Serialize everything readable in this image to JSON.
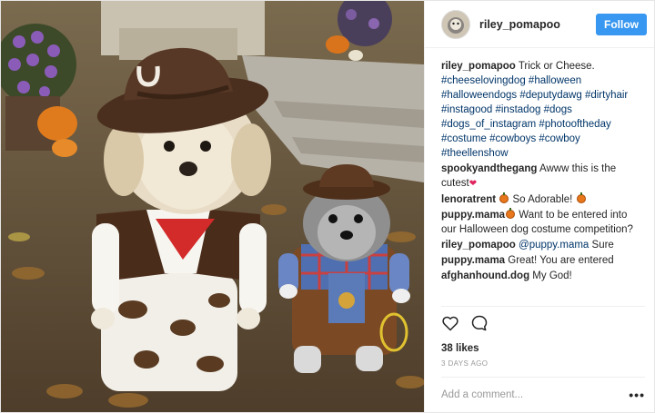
{
  "media": {
    "description_icon": "photo"
  },
  "header": {
    "username": "riley_pomapoo",
    "follow_label": "Follow"
  },
  "caption": {
    "author": "riley_pomapoo",
    "text": "Trick or Cheese.",
    "hashtags": [
      "#cheeselovingdog",
      "#halloween",
      "#halloweendogs",
      "#deputydawg",
      "#dirtyhair",
      "#instagood",
      "#instadog",
      "#dogs",
      "#dogs_of_instagram",
      "#photooftheday",
      "#costume",
      "#cowboys",
      "#cowboy",
      "#theellenshow"
    ]
  },
  "comments": [
    {
      "author": "spookyandthegang",
      "text": "Awww this is the cutest",
      "emoji": "heart"
    },
    {
      "author": "lenoratrent",
      "text": "So Adorable!",
      "emoji_before": "pumpkin",
      "emoji": "pumpkin"
    },
    {
      "author": "puppy.mama",
      "text": "Want to be entered into our Halloween dog costume competition?",
      "emoji_before": "pumpkin"
    },
    {
      "author": "riley_pomapoo",
      "mention": "@puppy.mama",
      "text": "Sure"
    },
    {
      "author": "puppy.mama",
      "text": "Great! You are entered"
    },
    {
      "author": "afghanhound.dog",
      "text": "My God!"
    }
  ],
  "actions": {
    "like_icon": "heart-outline-icon",
    "comment_icon": "speech-bubble-icon"
  },
  "likes": "38 likes",
  "date": "3 DAYS AGO",
  "add_comment": {
    "placeholder": "Add a comment..."
  },
  "more_label": "•••"
}
